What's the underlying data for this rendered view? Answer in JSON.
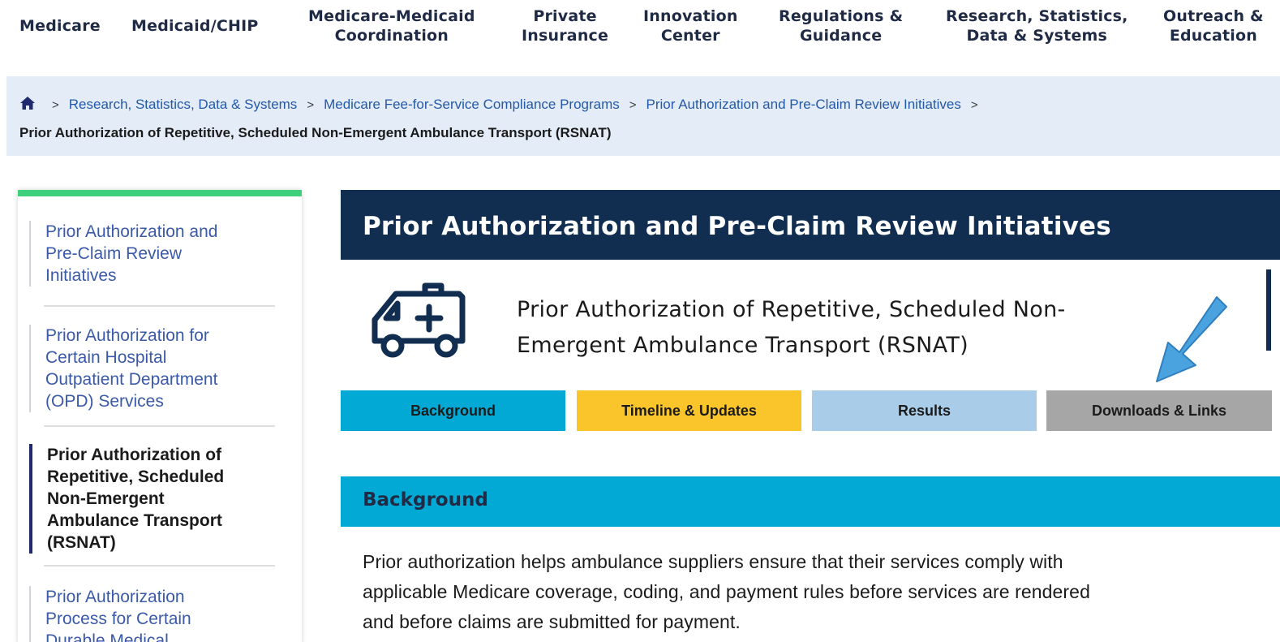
{
  "topnav": {
    "items": [
      {
        "label": "Medicare"
      },
      {
        "label": "Medicaid/CHIP"
      },
      {
        "line1": "Medicare-Medicaid",
        "line2": "Coordination"
      },
      {
        "line1": "Private",
        "line2": "Insurance"
      },
      {
        "line1": "Innovation",
        "line2": "Center"
      },
      {
        "line1": "Regulations &",
        "line2": "Guidance"
      },
      {
        "line1": "Research, Statistics,",
        "line2": "Data & Systems"
      },
      {
        "line1": "Outreach &",
        "line2": "Education"
      }
    ]
  },
  "breadcrumb": {
    "links": [
      "Research, Statistics, Data & Systems",
      "Medicare Fee-for-Service Compliance Programs",
      "Prior Authorization and Pre-Claim Review Initiatives"
    ],
    "current": "Prior Authorization of Repetitive, Scheduled Non-Emergent Ambulance Transport (RSNAT)"
  },
  "sidebar": {
    "items": [
      {
        "lines": [
          "Prior Authorization and",
          "Pre-Claim Review",
          "Initiatives"
        ]
      },
      {
        "lines": [
          "Prior Authorization for",
          "Certain Hospital",
          "Outpatient Department",
          "(OPD) Services"
        ]
      },
      {
        "lines": [
          "Prior Authorization of",
          "Repetitive, Scheduled",
          "Non-Emergent",
          "Ambulance Transport",
          "(RSNAT)"
        ]
      },
      {
        "lines": [
          "Prior Authorization",
          "Process for Certain",
          "Durable Medical"
        ]
      }
    ]
  },
  "main": {
    "header": "Prior Authorization and Pre-Claim Review Initiatives",
    "subtitle_line1": "Prior Authorization of Repetitive, Scheduled Non-",
    "subtitle_line2": "Emergent Ambulance Transport (RSNAT)",
    "tabs": [
      {
        "label": "Background",
        "color": "#02a9d5"
      },
      {
        "label": "Timeline & Updates",
        "color": "#fac52a"
      },
      {
        "label": "Results",
        "color": "#a9cde9"
      },
      {
        "label": "Downloads & Links",
        "color": "#a6a6a6"
      }
    ],
    "section_title": "Background",
    "section_text_line1": "Prior authorization helps ambulance suppliers ensure that their services comply with",
    "section_text_line2": "applicable Medicare coverage, coding, and payment rules before services are rendered",
    "section_text_line3": "and before claims are submitted for payment."
  },
  "icons": {
    "home": "home-icon",
    "ambulance": "ambulance-icon",
    "arrow": "arrow-pointer-icon"
  },
  "colors": {
    "navy": "#112e51",
    "accent_green": "#3fd07d",
    "arrow_blue": "#4aa3df"
  }
}
